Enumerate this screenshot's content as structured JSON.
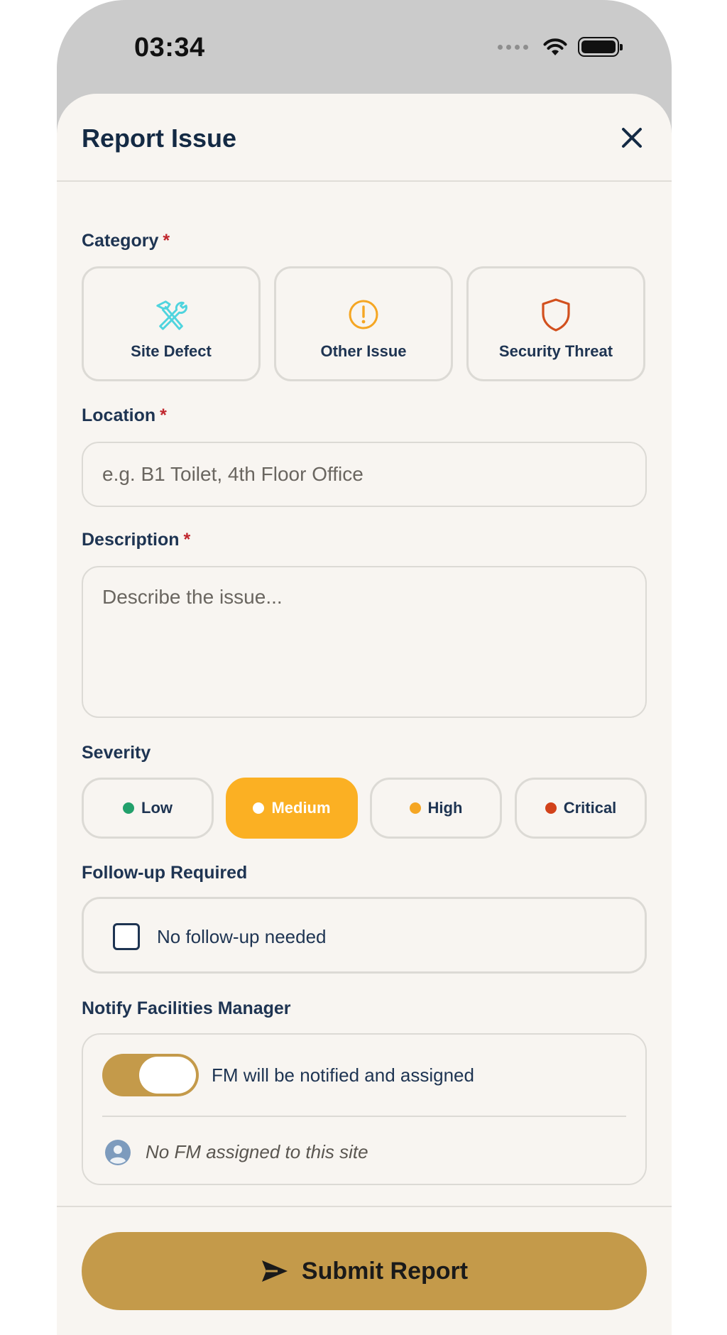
{
  "status_bar": {
    "time": "03:34"
  },
  "sheet": {
    "title": "Report Issue"
  },
  "category": {
    "label": "Category",
    "required_mark": "*",
    "options": [
      {
        "label": "Site Defect",
        "icon": "tools-icon",
        "color": "#4fd4de"
      },
      {
        "label": "Other Issue",
        "icon": "alert-circle-icon",
        "color": "#f5a623"
      },
      {
        "label": "Security Threat",
        "icon": "shield-icon",
        "color": "#d2501e"
      }
    ]
  },
  "location": {
    "label": "Location",
    "required_mark": "*",
    "placeholder": "e.g. B1 Toilet, 4th Floor Office",
    "value": ""
  },
  "description": {
    "label": "Description",
    "required_mark": "*",
    "placeholder": "Describe the issue...",
    "value": ""
  },
  "severity": {
    "label": "Severity",
    "selected": "Medium",
    "options": [
      {
        "label": "Low",
        "dot_color": "#22a06b"
      },
      {
        "label": "Medium",
        "dot_color": "#ffffff"
      },
      {
        "label": "High",
        "dot_color": "#f5a623"
      },
      {
        "label": "Critical",
        "dot_color": "#d2421a"
      }
    ]
  },
  "followup": {
    "label": "Follow-up Required",
    "checkbox_label": "No follow-up needed",
    "checked": false
  },
  "notify": {
    "label": "Notify Facilities Manager",
    "toggle_on": true,
    "toggle_text": "FM will be notified and assigned",
    "fm_status": "No FM assigned to this site"
  },
  "submit": {
    "label": "Submit Report"
  },
  "colors": {
    "accent": "#c49a4a",
    "severity_active": "#fbb023",
    "text_primary": "#1e3452",
    "required": "#c0262d"
  }
}
